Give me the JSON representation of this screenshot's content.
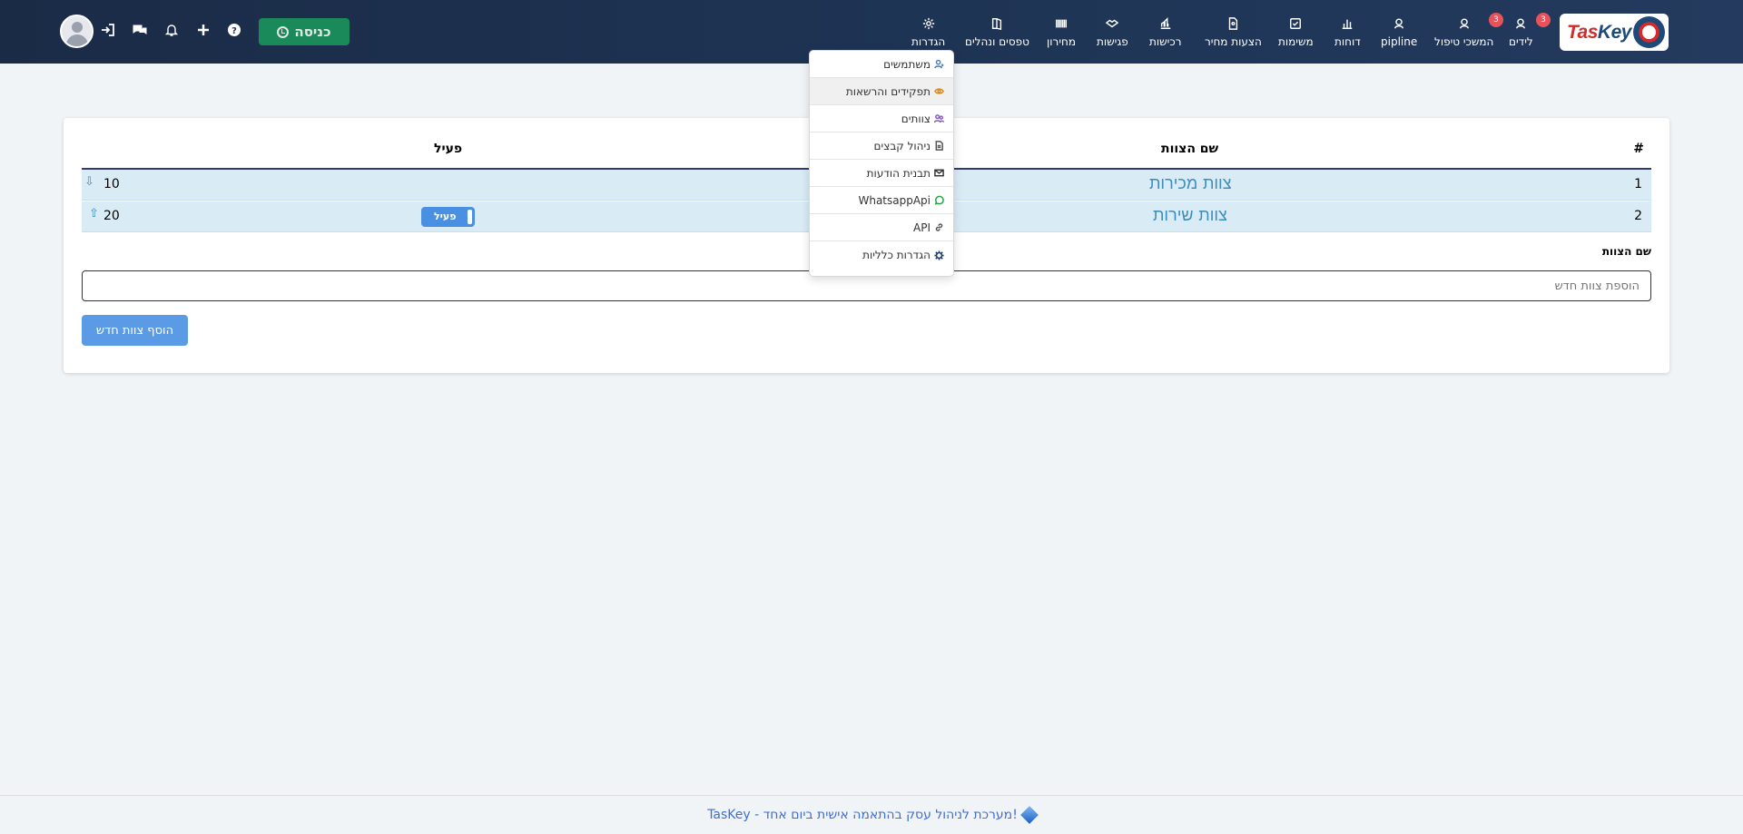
{
  "nav": {
    "logo_text_main": "Tas",
    "logo_text_accent": "Key",
    "items": [
      {
        "label": "לידים",
        "icon": "user-icon",
        "badge": "3"
      },
      {
        "label": "המשכי טיפול",
        "icon": "user-icon",
        "badge": "3"
      },
      {
        "label": "pipline",
        "icon": "user-icon"
      },
      {
        "label": "דוחות",
        "icon": "bar-chart-icon"
      },
      {
        "label": "משימות",
        "icon": "checkbox-icon"
      },
      {
        "label": "הצעות מחיר",
        "icon": "document-icon"
      },
      {
        "label": "רכישות",
        "icon": "chart-icon"
      },
      {
        "label": "פגישות",
        "icon": "handshake-icon"
      },
      {
        "label": "מחירון",
        "icon": "barcode-icon"
      },
      {
        "label": "טפסים ונהלים",
        "icon": "book-icon"
      },
      {
        "label": "הגדרות",
        "icon": "gear-icon"
      }
    ],
    "checkin_label": "כניסה"
  },
  "settings_menu": {
    "items": [
      {
        "label": "משתמשים",
        "icon": "users-icon",
        "color": "#4a7ec4"
      },
      {
        "label": "תפקידים והרשאות",
        "icon": "eye-icon",
        "color": "#e08a1e"
      },
      {
        "label": "צוותים",
        "icon": "team-icon",
        "color": "#8a5cc4"
      },
      {
        "label": "ניהול קבצים",
        "icon": "file-icon",
        "color": "#555555"
      },
      {
        "label": "תבנית הודעות",
        "icon": "envelope-icon",
        "color": "#333333"
      },
      {
        "label": "WhatsappApi",
        "icon": "whatsapp-icon",
        "color": "#25a244"
      },
      {
        "label": "API",
        "icon": "link-icon",
        "color": "#555555"
      },
      {
        "label": "הגדרות כלליות",
        "icon": "gear-icon",
        "color": "#1e3a6e"
      }
    ]
  },
  "table": {
    "headers": {
      "num": "#",
      "name": "שם הצוות",
      "active": "פעיל"
    },
    "rows": [
      {
        "num": "1",
        "name": "צוות מכירות",
        "sort": "10",
        "arrow": "⇩",
        "active": ""
      },
      {
        "num": "2",
        "name": "צוות שירות",
        "sort": "20",
        "arrow": "⇧",
        "active": "פעיל"
      }
    ]
  },
  "form": {
    "label": "שם הצוות",
    "placeholder": "הוספת צוות חדש",
    "add_button": "הוסף צוות חדש"
  },
  "footer": {
    "text": "TasKey - מערכת לניהול עסק בהתאמה אישית ביום אחד!"
  },
  "colors": {
    "navbar": "#1f3556",
    "accent": "#3c8dbc",
    "checkin": "#1b8a5a",
    "badge": "#e8525a"
  }
}
